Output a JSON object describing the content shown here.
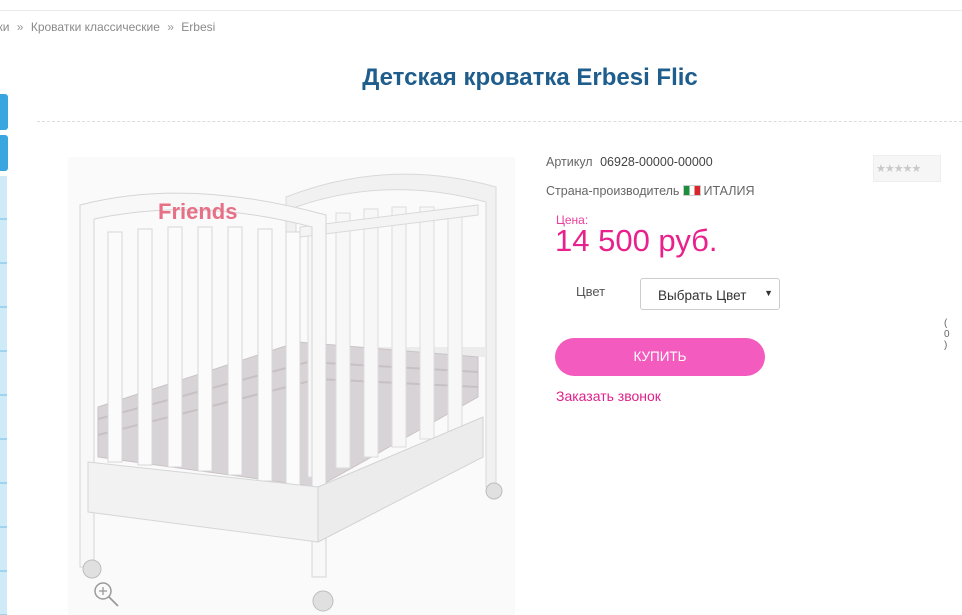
{
  "breadcrumb": {
    "items": [
      "тки",
      "Кроватки классические",
      "Erbesi"
    ],
    "separator": "»"
  },
  "product": {
    "title": "Детская кроватка Erbesi Flic",
    "article_label": "Артикул",
    "article_value": "06928-00000-00000",
    "country_label": "Страна-производитель",
    "country_value": "ИТАЛИЯ",
    "price_label": "Цена:",
    "price_value": "14 500 руб.",
    "color_label": "Цвет",
    "color_select_value": "Выбрать Цвет",
    "buy_label": "КУПИТЬ",
    "callback_label": "Заказать звонок",
    "headboard_logo_text": "Friends"
  },
  "rating": {
    "stars": "★★★★★",
    "count": "( 0 )"
  },
  "colors": {
    "title": "#1e5d8c",
    "price": "#e8218c",
    "button": "#f35cbe",
    "link": "#e0208b",
    "side_tab": "#39a6e0"
  },
  "icons": {
    "zoom": "magnifier-plus-icon",
    "flag": "italy-flag-icon",
    "dropdown": "chevron-down-icon"
  }
}
